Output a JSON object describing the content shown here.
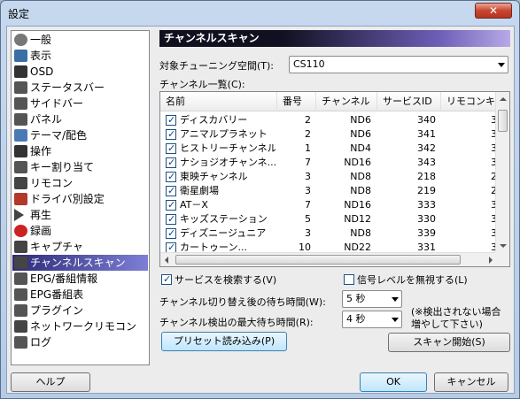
{
  "window": {
    "title": "設定",
    "close_glyph": "✕"
  },
  "sidebar": {
    "items": [
      {
        "label": "一般",
        "icon": "gear-icon",
        "color": "#777777"
      },
      {
        "label": "表示",
        "icon": "display-icon",
        "color": "#3a6ea5"
      },
      {
        "label": "OSD",
        "icon": "osd-icon",
        "color": "#333333"
      },
      {
        "label": "ステータスバー",
        "icon": "statusbar-icon",
        "color": "#555555"
      },
      {
        "label": "サイドバー",
        "icon": "sidebar-icon",
        "color": "#555555"
      },
      {
        "label": "パネル",
        "icon": "panel-icon",
        "color": "#555555"
      },
      {
        "label": "テーマ/配色",
        "icon": "theme-icon",
        "color": "#4a7ab5"
      },
      {
        "label": "操作",
        "icon": "hand-icon",
        "color": "#333333"
      },
      {
        "label": "キー割り当て",
        "icon": "keyboard-icon",
        "color": "#555555"
      },
      {
        "label": "リモコン",
        "icon": "remote-icon",
        "color": "#444444"
      },
      {
        "label": "ドライバ別設定",
        "icon": "driver-icon",
        "color": "#b33a2a"
      },
      {
        "label": "再生",
        "icon": "play-icon",
        "color": "#444444"
      },
      {
        "label": "録画",
        "icon": "record-icon",
        "color": "#cc2222"
      },
      {
        "label": "キャプチャ",
        "icon": "camera-icon",
        "color": "#444444"
      },
      {
        "label": "チャンネルスキャン",
        "icon": "scan-icon",
        "color": "#444444"
      },
      {
        "label": "EPG/番組情報",
        "icon": "epg-icon",
        "color": "#555555"
      },
      {
        "label": "EPG番組表",
        "icon": "epg-table-icon",
        "color": "#555555"
      },
      {
        "label": "プラグイン",
        "icon": "plugin-icon",
        "color": "#555555"
      },
      {
        "label": "ネットワークリモコン",
        "icon": "network-remote-icon",
        "color": "#444444"
      },
      {
        "label": "ログ",
        "icon": "log-icon",
        "color": "#555555"
      }
    ],
    "selected_index": 14
  },
  "panel": {
    "heading": "チャンネルスキャン",
    "tuning_space_label": "対象チューニング空間(T):",
    "tuning_space_value": "CS110",
    "channel_list_label": "チャンネル一覧(C):",
    "columns": [
      "名前",
      "番号",
      "チャンネル",
      "サービスID",
      "リモコンキ"
    ],
    "rows": [
      {
        "name": "ディスカバリー",
        "num": "2",
        "ch": "ND6",
        "sid": "340",
        "rc": "3"
      },
      {
        "name": "アニマルプラネット",
        "num": "2",
        "ch": "ND6",
        "sid": "341",
        "rc": "3"
      },
      {
        "name": "ヒストリーチャンネル",
        "num": "1",
        "ch": "ND4",
        "sid": "342",
        "rc": "3"
      },
      {
        "name": "ナショジオチャンネ...",
        "num": "7",
        "ch": "ND16",
        "sid": "343",
        "rc": "3"
      },
      {
        "name": "東映チャンネル",
        "num": "3",
        "ch": "ND8",
        "sid": "218",
        "rc": "2"
      },
      {
        "name": "衛星劇場",
        "num": "3",
        "ch": "ND8",
        "sid": "219",
        "rc": "2"
      },
      {
        "name": "AT－X",
        "num": "7",
        "ch": "ND16",
        "sid": "333",
        "rc": "3"
      },
      {
        "name": "キッズステーション",
        "num": "5",
        "ch": "ND12",
        "sid": "330",
        "rc": "3"
      },
      {
        "name": "ディズニージュニア",
        "num": "3",
        "ch": "ND8",
        "sid": "339",
        "rc": "3"
      },
      {
        "name": "カートゥーン...",
        "num": "10",
        "ch": "ND22",
        "sid": "331",
        "rc": "3"
      }
    ],
    "search_services_label": "サービスを検索する(V)",
    "search_services_checked": true,
    "ignore_signal_label": "信号レベルを無視する(L)",
    "ignore_signal_checked": false,
    "wait_label": "チャンネル切り替え後の待ち時間(W):",
    "wait_value": "5 秒",
    "max_wait_label": "チャンネル検出の最大待ち時間(R):",
    "max_wait_value": "4 秒",
    "note": "(※検出されない場合\n増やして下さい)",
    "preset_button": "プリセット読み込み(P)",
    "scan_button": "スキャン開始(S)"
  },
  "footer": {
    "help": "ヘルプ",
    "ok": "OK",
    "cancel": "キャンセル"
  }
}
